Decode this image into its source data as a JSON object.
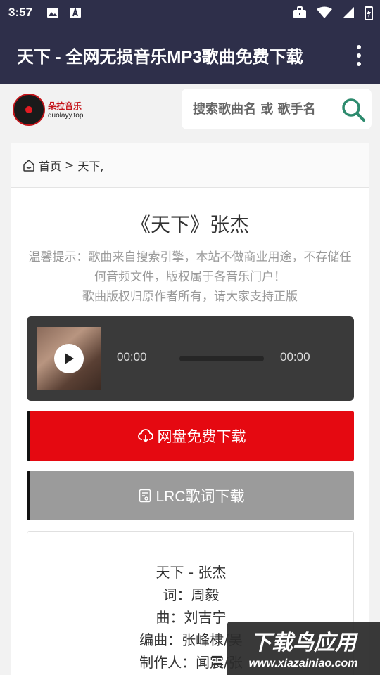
{
  "status_bar": {
    "time": "3:57"
  },
  "app_bar": {
    "title": "天下 - 全网无损音乐MP3歌曲免费下载"
  },
  "site": {
    "logo_cn": "朵拉音乐",
    "logo_en": "duolayy.top",
    "search_placeholder": "搜索歌曲名 或 歌手名"
  },
  "breadcrumb": {
    "home": "首页",
    "separator": ">",
    "current": "天下,"
  },
  "song": {
    "title": "《天下》张杰",
    "notice_line1": "温馨提示：歌曲来自搜索引擎，本站不做商业用途，不存储任何音频文件，版权属于各音乐门户！",
    "notice_line2": "歌曲版权归原作者所有，请大家支持正版"
  },
  "player": {
    "current_time": "00:00",
    "total_time": "00:00",
    "progress": 0
  },
  "buttons": {
    "download": "网盘免费下载",
    "lrc": "LRC歌词下载"
  },
  "lyrics": [
    "天下 - 张杰",
    "词：周毅",
    "曲：刘吉宁",
    "编曲：张峰棣/吴",
    "制作人：闻震/张"
  ],
  "watermark": {
    "cn": "下载鸟应用",
    "en": "www.xiazainiao.com"
  },
  "colors": {
    "app_bar": "#2e2f4a",
    "download_btn": "#e50911",
    "lrc_btn": "#9b9b9b",
    "player_bg": "#3a3a3a",
    "search_icon": "#2e8b6e"
  }
}
